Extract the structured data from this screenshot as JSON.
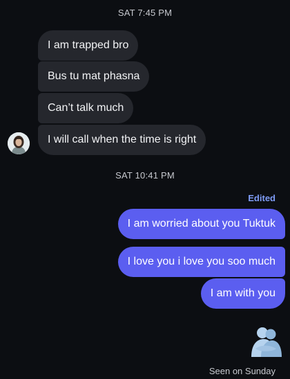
{
  "conversation": {
    "timestamps": [
      "SAT 7:45 PM",
      "SAT 10:41 PM"
    ],
    "incoming": [
      "I am trapped bro",
      "Bus tu mat phasna",
      "Can’t talk much",
      "I will call when the time is right"
    ],
    "edited_label": "Edited",
    "outgoing": [
      "I am worried about you Tuktuk",
      "I love you i love you soo much",
      "I am with you"
    ],
    "seen_status": "Seen on Sunday"
  },
  "colors": {
    "background": "#0c0e12",
    "incoming_bubble": "#25272d",
    "outgoing_bubble": "#5b5ef0",
    "edited_label": "#7f9cf6",
    "sticker": "#a9c8e6"
  },
  "icons": {
    "avatar": "contact-avatar",
    "sticker": "hug-sticker"
  }
}
